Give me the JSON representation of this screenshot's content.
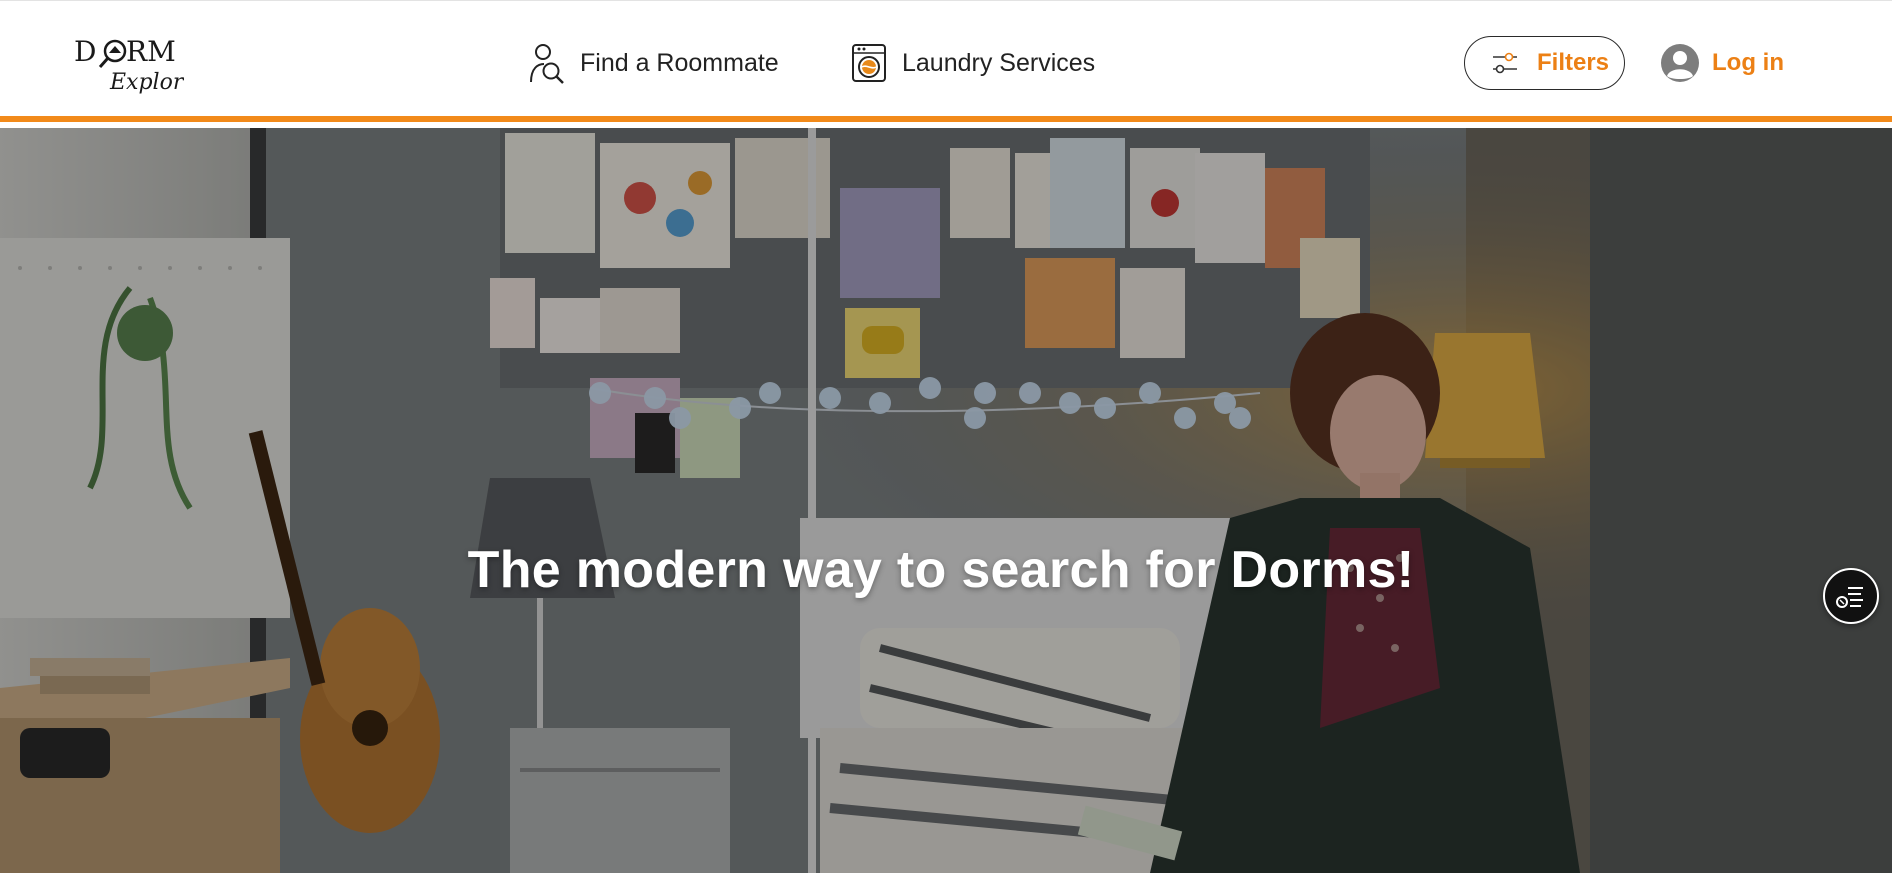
{
  "logo": {
    "line1": "DORM",
    "line2": "Explorer"
  },
  "nav": {
    "roommate": {
      "label": "Find a Roommate",
      "icon": "person-search-icon"
    },
    "laundry": {
      "label": "Laundry Services",
      "icon": "washing-machine-icon"
    }
  },
  "actions": {
    "filters": {
      "label": "Filters",
      "icon": "sliders-icon"
    },
    "login": {
      "label": "Log in",
      "icon": "user-avatar-icon"
    }
  },
  "hero": {
    "title": "The modern way to search for Dorms!",
    "side_button_icon": "filter-list-icon"
  },
  "colors": {
    "accent": "#ec8015",
    "header_border": "#f28a1a",
    "text": "#222222"
  }
}
